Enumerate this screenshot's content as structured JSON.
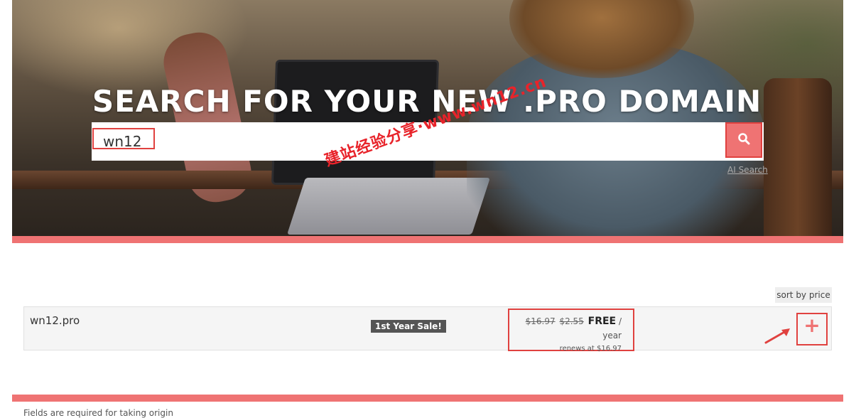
{
  "hero": {
    "title": "SEARCH FOR YOUR NEW .PRO DOMAIN",
    "watermark": "建站经验分享·www.wn12.cn"
  },
  "search": {
    "value": "wn12",
    "button_icon": "search-icon",
    "ai_link": "AI Search"
  },
  "results": {
    "sort_label": "sort by price",
    "items": [
      {
        "domain": "wn12.pro",
        "badge": "1st Year Sale!",
        "old_price_1": "$16.97",
        "old_price_2": "$2.55",
        "price": "FREE",
        "period": "/ year",
        "renews": "renews at $16.97",
        "add_label": "+"
      }
    ]
  },
  "footer": {
    "text": "Fields are required for taking origin"
  },
  "colors": {
    "accent": "#ef7373",
    "highlight": "#e0413f"
  }
}
